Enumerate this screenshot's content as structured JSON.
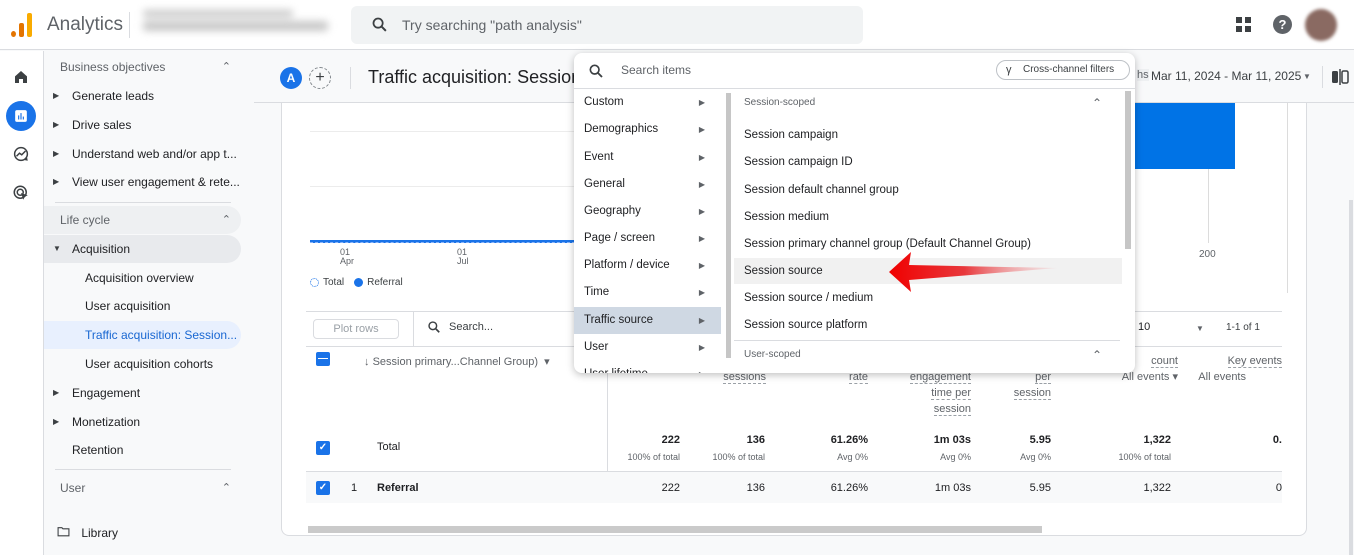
{
  "app": {
    "brand": "Analytics",
    "search_placeholder": "Try searching \"path analysis\""
  },
  "topbar_icons": [
    "apps-icon",
    "help-icon",
    "avatar"
  ],
  "rail": [
    "home-icon",
    "reports-icon",
    "explore-icon",
    "advertising-icon"
  ],
  "sidebar": {
    "sections": [
      {
        "label": "Business objectives",
        "items": [
          {
            "label": "Generate leads",
            "expandable": true
          },
          {
            "label": "Drive sales",
            "expandable": true
          },
          {
            "label": "Understand web and/or app t...",
            "expandable": true
          },
          {
            "label": "View user engagement & rete...",
            "expandable": true
          }
        ]
      },
      {
        "label": "Life cycle",
        "items": [
          {
            "label": "Acquisition",
            "expanded": true
          },
          {
            "label": "Acquisition overview"
          },
          {
            "label": "User acquisition"
          },
          {
            "label": "Traffic acquisition: Session...",
            "selected": true
          },
          {
            "label": "User acquisition cohorts"
          },
          {
            "label": "Engagement",
            "expandable": true
          },
          {
            "label": "Monetization",
            "expandable": true
          },
          {
            "label": "Retention"
          }
        ]
      },
      {
        "label": "User",
        "items": []
      }
    ],
    "library_label": "Library"
  },
  "header": {
    "segment_badge": "A",
    "add_segment": "+",
    "title": "Traffic acquisition: Session",
    "date_prefix": "hs",
    "date_range": "Mar 11, 2024 - Mar 11, 2025"
  },
  "chart": {
    "x_ticks": [
      {
        "day": "01",
        "month": "Apr"
      },
      {
        "day": "01",
        "month": "Jul"
      }
    ],
    "legend": [
      "Total",
      "Referral"
    ],
    "bar_tick": "200"
  },
  "dropdown": {
    "search_placeholder": "Search items",
    "cross_channel_label": "Cross-channel filters",
    "categories": [
      "Custom",
      "Demographics",
      "Event",
      "General",
      "Geography",
      "Page / screen",
      "Platform / device",
      "Time",
      "Traffic source",
      "User",
      "User lifetime"
    ],
    "selected_category": "Traffic source",
    "groups": [
      {
        "label": "Session-scoped",
        "items": [
          "Session campaign",
          "Session campaign ID",
          "Session default channel group",
          "Session medium",
          "Session primary channel group (Default Channel Group)",
          "Session source",
          "Session source / medium",
          "Session source platform"
        ]
      },
      {
        "label": "User-scoped",
        "items": []
      }
    ],
    "hovered_item": "Session source"
  },
  "table": {
    "plot_rows_label": "Plot rows",
    "search_placeholder": "Search...",
    "rows_per_page": "10",
    "pager": "1-1 of 1",
    "dimension_header": "Session primary...Channel Group)",
    "metric_headers": [
      [
        "sessions"
      ],
      [
        "rate"
      ],
      [
        "engagement",
        "time per",
        "session"
      ],
      [
        "per",
        "session"
      ],
      [
        "count",
        "All events"
      ],
      [
        "Key events",
        "All events"
      ]
    ],
    "total": {
      "label": "Total",
      "values": [
        "222",
        "136",
        "61.26%",
        "1m 03s",
        "5.95",
        "1,322",
        "0."
      ],
      "subs": [
        "100% of total",
        "100% of total",
        "Avg 0%",
        "Avg 0%",
        "Avg 0%",
        "100% of total",
        ""
      ]
    },
    "rows": [
      {
        "index": "1",
        "label": "Referral",
        "values": [
          "222",
          "136",
          "61.26%",
          "1m 03s",
          "5.95",
          "1,322",
          "0"
        ]
      }
    ]
  }
}
